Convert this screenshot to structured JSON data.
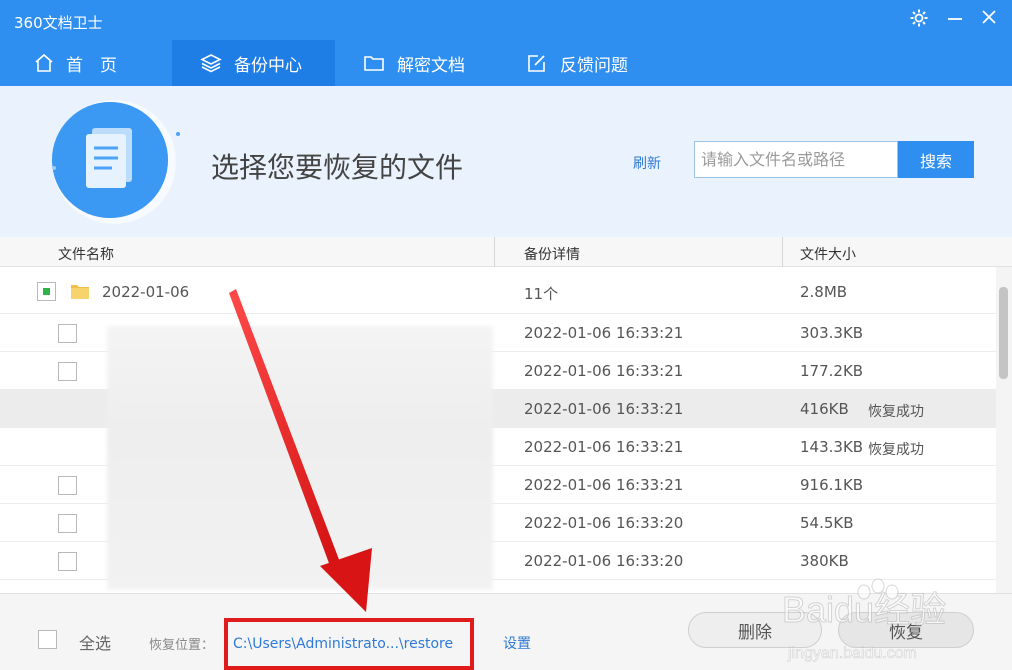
{
  "window": {
    "title": "360文档卫士"
  },
  "nav": {
    "tabs": [
      {
        "label": "首　页",
        "icon": "home-icon"
      },
      {
        "label": "备份中心",
        "icon": "layers-icon",
        "active": true
      },
      {
        "label": "解密文档",
        "icon": "folder-icon"
      },
      {
        "label": "反馈问题",
        "icon": "edit-icon"
      }
    ]
  },
  "hero": {
    "title": "选择您要恢复的文件",
    "refresh_label": "刷新",
    "search_placeholder": "请输入文件名或路径",
    "search_button": "搜索"
  },
  "table": {
    "headers": [
      "文件名称",
      "备份详情",
      "文件大小"
    ],
    "group": {
      "name": "2022-01-06",
      "detail": "11个",
      "size": "2.8MB"
    },
    "rows": [
      {
        "detail": "2022-01-06 16:33:21",
        "size": "303.3KB",
        "status": "",
        "checkbox": true,
        "selected": false
      },
      {
        "detail": "2022-01-06 16:33:21",
        "size": "177.2KB",
        "status": "",
        "checkbox": true,
        "selected": false
      },
      {
        "detail": "2022-01-06 16:33:21",
        "size": "416KB",
        "status": "恢复成功",
        "checkbox": false,
        "selected": true
      },
      {
        "detail": "2022-01-06 16:33:21",
        "size": "143.3KB",
        "status": "恢复成功",
        "checkbox": false,
        "selected": false
      },
      {
        "detail": "2022-01-06 16:33:21",
        "size": "916.1KB",
        "status": "",
        "checkbox": true,
        "selected": false
      },
      {
        "detail": "2022-01-06 16:33:20",
        "size": "54.5KB",
        "status": "",
        "checkbox": true,
        "selected": false
      },
      {
        "detail": "2022-01-06 16:33:20",
        "size": "380KB",
        "status": "",
        "checkbox": true,
        "selected": false
      }
    ]
  },
  "footer": {
    "select_all": "全选",
    "restore_path_label": "恢复位置：",
    "restore_path": "C:\\Users\\Administrato...\\restore",
    "settings_link": "设置",
    "delete_button": "删除",
    "restore_button": "恢复"
  },
  "watermark": {
    "text": "Baidu经验",
    "subtext": "jingyan.baidu.com"
  },
  "colors": {
    "primary": "#2f8ff1",
    "annotation": "#e01b1b",
    "check": "#2eb34b"
  }
}
